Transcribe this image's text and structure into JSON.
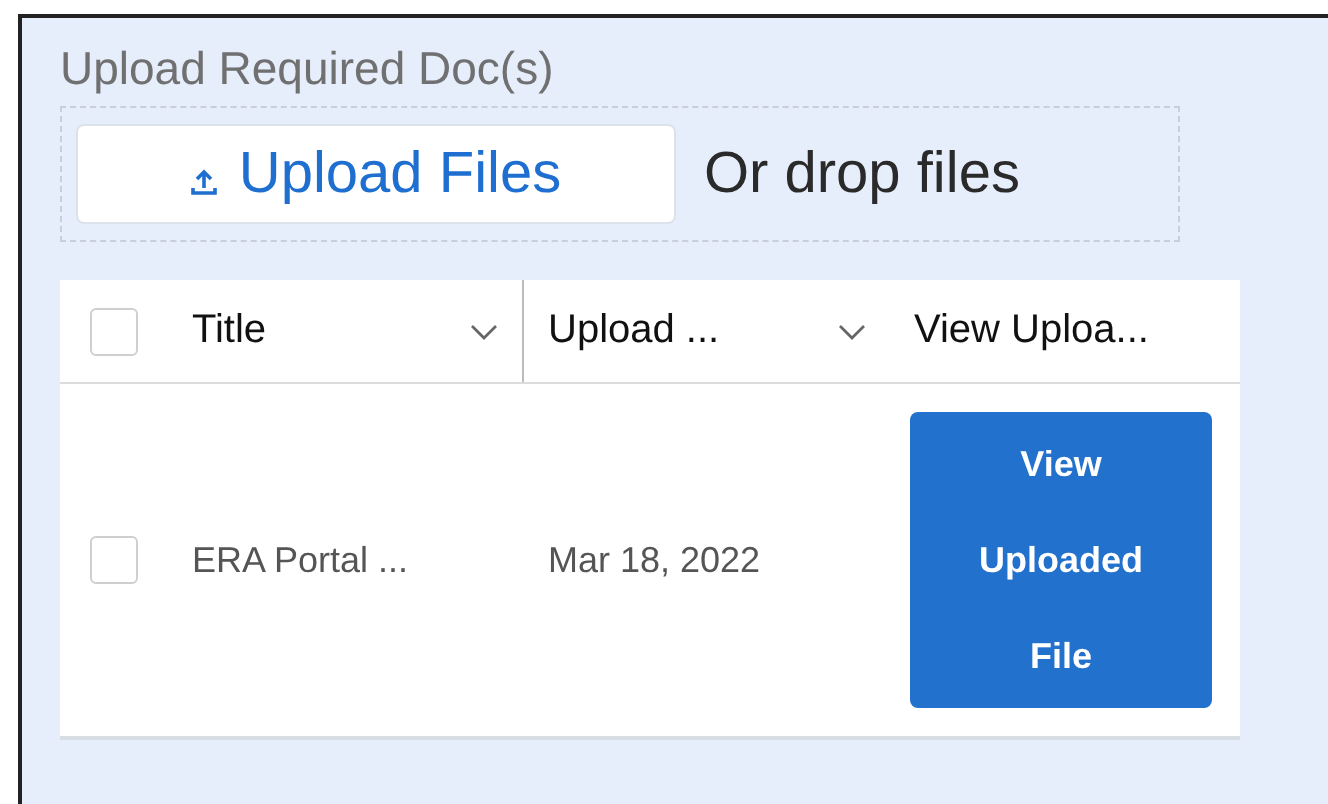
{
  "section_title": "Upload Required Doc(s)",
  "dropzone": {
    "button": "Upload Files",
    "hint": "Or drop files"
  },
  "table": {
    "header_checkbox": {
      "checked": false
    },
    "columns": [
      {
        "label": "Title",
        "sortable": true
      },
      {
        "label": "Upload ...",
        "sortable": true
      },
      {
        "label": "View Uploa...",
        "sortable": false
      }
    ],
    "rows": [
      {
        "checked": false,
        "title": "ERA Portal ...",
        "date": "Mar 18, 2022",
        "action": "View Uploaded File"
      }
    ]
  }
}
